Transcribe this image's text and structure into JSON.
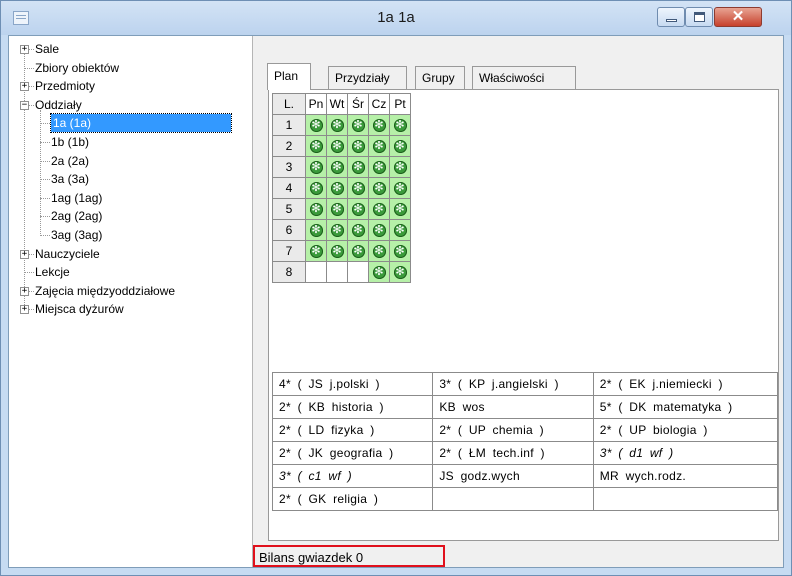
{
  "window": {
    "title": "1a 1a"
  },
  "tree": {
    "nodes": [
      {
        "label": "Sale",
        "expander": "+",
        "level": 0
      },
      {
        "label": "Zbiory obiektów",
        "expander": "",
        "level": 0
      },
      {
        "label": "Przedmioty",
        "expander": "+",
        "level": 0
      },
      {
        "label": "Oddziały",
        "expander": "−",
        "level": 0
      },
      {
        "label": "1a (1a)",
        "expander": "",
        "level": 1,
        "selected": true
      },
      {
        "label": "1b (1b)",
        "expander": "",
        "level": 1
      },
      {
        "label": "2a (2a)",
        "expander": "",
        "level": 1
      },
      {
        "label": "3a (3a)",
        "expander": "",
        "level": 1
      },
      {
        "label": "1ag (1ag)",
        "expander": "",
        "level": 1
      },
      {
        "label": "2ag (2ag)",
        "expander": "",
        "level": 1
      },
      {
        "label": "3ag (3ag)",
        "expander": "",
        "level": 1
      },
      {
        "label": "Nauczyciele",
        "expander": "+",
        "level": 0
      },
      {
        "label": "Lekcje",
        "expander": "",
        "level": 0
      },
      {
        "label": "Zajęcia międzyoddziałowe",
        "expander": "+",
        "level": 0
      },
      {
        "label": "Miejsca dyżurów",
        "expander": "+",
        "level": 0
      }
    ]
  },
  "tabs": [
    "Plan",
    "Przydziały",
    "Grupy",
    "Właściwości"
  ],
  "plan": {
    "corner": "L.",
    "days": [
      "Pn",
      "Wt",
      "Śr",
      "Cz",
      "Pt"
    ],
    "rows": [
      {
        "n": "1",
        "cells": [
          1,
          1,
          1,
          1,
          1
        ]
      },
      {
        "n": "2",
        "cells": [
          1,
          1,
          1,
          1,
          1
        ]
      },
      {
        "n": "3",
        "cells": [
          1,
          1,
          1,
          1,
          1
        ]
      },
      {
        "n": "4",
        "cells": [
          1,
          1,
          1,
          1,
          1
        ]
      },
      {
        "n": "5",
        "cells": [
          1,
          1,
          1,
          1,
          1
        ]
      },
      {
        "n": "6",
        "cells": [
          1,
          1,
          1,
          1,
          1
        ]
      },
      {
        "n": "7",
        "cells": [
          1,
          1,
          1,
          1,
          1
        ]
      },
      {
        "n": "8",
        "cells": [
          0,
          0,
          0,
          1,
          1
        ]
      }
    ],
    "cell_icon": "green-star-icon",
    "cell_on_color": "#b6f0a8"
  },
  "subjects": [
    [
      {
        "text": "4* ( JS j.polski )",
        "italic": false
      },
      {
        "text": "3* ( KP j.angielski )",
        "italic": false
      },
      {
        "text": "2* ( EK j.niemiecki )",
        "italic": false
      }
    ],
    [
      {
        "text": "2* ( KB historia )",
        "italic": false
      },
      {
        "text": "KB wos",
        "italic": false
      },
      {
        "text": "5* ( DK matematyka )",
        "italic": false
      }
    ],
    [
      {
        "text": "2* ( LD fizyka )",
        "italic": false
      },
      {
        "text": "2* ( UP chemia )",
        "italic": false
      },
      {
        "text": "2* ( UP biologia )",
        "italic": false
      }
    ],
    [
      {
        "text": "2* ( JK geografia )",
        "italic": false
      },
      {
        "text": "2* ( ŁM tech.inf )",
        "italic": false
      },
      {
        "text": "3* ( d1 wf )",
        "italic": true
      }
    ],
    [
      {
        "text": "3* ( c1 wf )",
        "italic": true
      },
      {
        "text": "JS godz.wych",
        "italic": false
      },
      {
        "text": "MR wych.rodz.",
        "italic": false
      }
    ],
    [
      {
        "text": "2* ( GK religia )",
        "italic": false
      },
      {
        "text": "",
        "italic": false
      },
      {
        "text": "",
        "italic": false
      }
    ]
  ],
  "status": {
    "text": "Bilans gwiazdek 0",
    "highlight_color": "#e0101c"
  }
}
